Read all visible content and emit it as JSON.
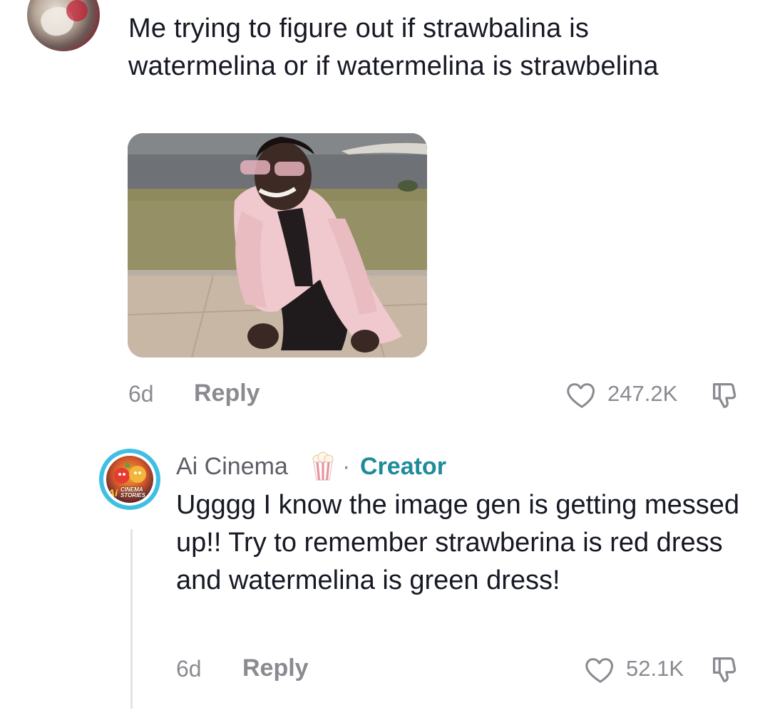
{
  "top_comment": {
    "text": "Me trying to figure out if strawbalina is watermelina or if watermelina is strawbelina",
    "time": "6d",
    "reply_label": "Reply",
    "likes": "247.2K"
  },
  "reply_comment": {
    "author": "Ai Cinema",
    "author_emoji_icon": "popcorn-icon",
    "separator": "·",
    "badge": "Creator",
    "avatar_text_ai": "Ai",
    "avatar_text_line1": "CINEMA",
    "avatar_text_line2": "STORIES",
    "text": "Ugggg I know the image gen is getting messed up!! Try to remember strawberina is red dress and watermelina is green dress!",
    "time": "6d",
    "reply_label": "Reply",
    "likes": "52.1K"
  },
  "colors": {
    "text": "#161823",
    "muted": "#8a8b91",
    "creator": "#1e8b9a",
    "avatar_ring": "#3fbfe3"
  }
}
